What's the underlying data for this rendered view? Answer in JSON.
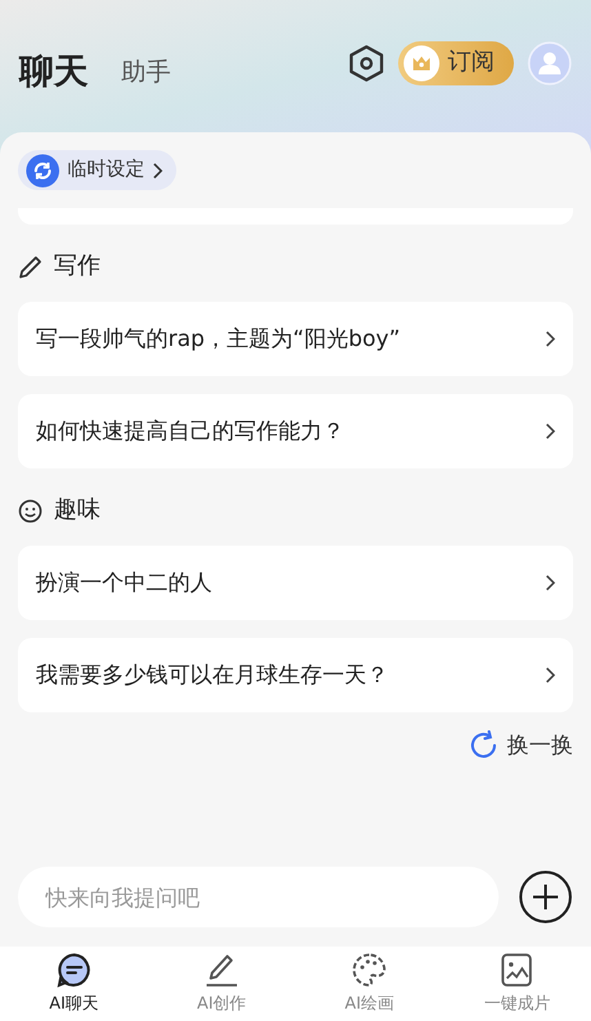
{
  "header_tabs": [
    {
      "label": "聊天",
      "selected": true
    },
    {
      "label": "助手",
      "selected": false
    }
  ],
  "subscribe_button": {
    "label": "订阅"
  },
  "settings_chip": {
    "label": "临时设定"
  },
  "sections": [
    {
      "title": "写作",
      "kind": "pencil",
      "prompts": [
        "写一段帅气的rap，主题为“阳光boy”",
        "如何快速提高自己的写作能力？"
      ]
    },
    {
      "title": "趣味",
      "kind": "smile",
      "prompts": [
        "扮演一个中二的人",
        "我需要多少钱可以在月球生存一天？"
      ]
    }
  ],
  "refresh_button": {
    "label": "换一换"
  },
  "input": {
    "placeholder": "快来向我提问吧"
  },
  "nav": [
    {
      "label": "AI聊天",
      "kind": "chat",
      "selected": true
    },
    {
      "label": "AI创作",
      "kind": "pen",
      "selected": false
    },
    {
      "label": "AI绘画",
      "kind": "palette",
      "selected": false
    },
    {
      "label": "一键成片",
      "kind": "image",
      "selected": false
    }
  ]
}
